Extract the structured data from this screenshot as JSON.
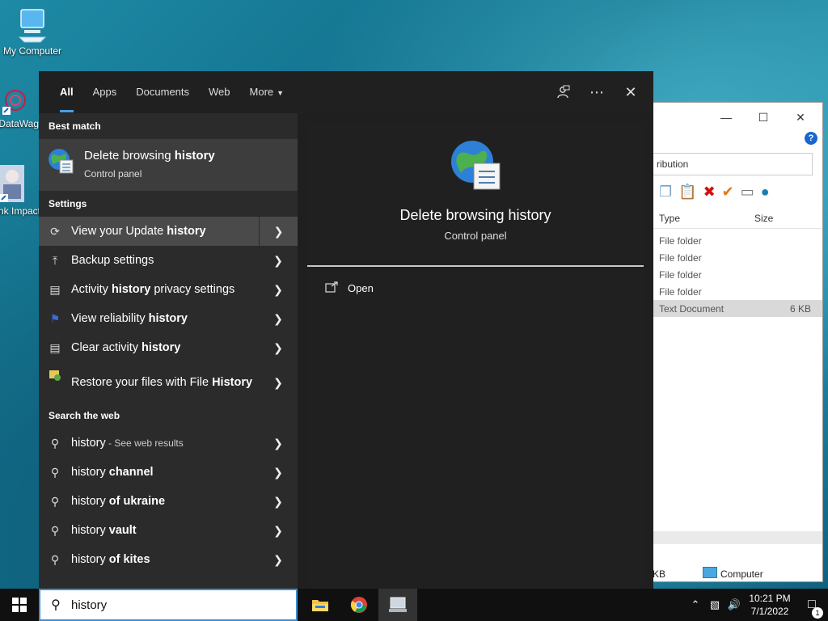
{
  "desktop": {
    "icons": [
      {
        "label": "My Computer"
      },
      {
        "label": "DataWag"
      },
      {
        "label": "Honk Impact"
      }
    ]
  },
  "explorer": {
    "address_partial": "ribution",
    "columns": {
      "type": "Type",
      "size": "Size"
    },
    "rows": [
      {
        "type": "File folder",
        "size": ""
      },
      {
        "type": "File folder",
        "size": ""
      },
      {
        "type": "File folder",
        "size": ""
      },
      {
        "type": "File folder",
        "size": ""
      },
      {
        "type": "Text Document",
        "size": "6 KB"
      }
    ],
    "status_left": "KB",
    "status_location": "Computer"
  },
  "search": {
    "tabs": [
      {
        "label": "All"
      },
      {
        "label": "Apps"
      },
      {
        "label": "Documents"
      },
      {
        "label": "Web"
      },
      {
        "label": "More"
      }
    ],
    "best_match_heading": "Best match",
    "best_match": {
      "title_pre": "Delete browsing ",
      "title_bold": "history",
      "subtitle": "Control panel"
    },
    "settings_heading": "Settings",
    "settings": [
      {
        "pre": "View your Update ",
        "bold": "history",
        "post": "",
        "icon": "refresh-icon"
      },
      {
        "pre": "Backup settings",
        "bold": "",
        "post": "",
        "icon": "upload-arrow-icon"
      },
      {
        "pre": "Activity ",
        "bold": "history",
        "post": " privacy settings",
        "icon": "timeline-icon"
      },
      {
        "pre": "View reliability ",
        "bold": "history",
        "post": "",
        "icon": "flag-icon"
      },
      {
        "pre": "Clear activity ",
        "bold": "history",
        "post": "",
        "icon": "timeline-icon"
      },
      {
        "pre": "Restore your files with File ",
        "bold": "History",
        "post": "",
        "icon": "file-history-icon"
      }
    ],
    "web_heading": "Search the web",
    "web": [
      {
        "pre": "history",
        "bold": "",
        "note": " - See web results"
      },
      {
        "pre": "history ",
        "bold": "channel",
        "note": ""
      },
      {
        "pre": "history ",
        "bold": "of ukraine",
        "note": ""
      },
      {
        "pre": "history ",
        "bold": "vault",
        "note": ""
      },
      {
        "pre": "history ",
        "bold": "of kites",
        "note": ""
      }
    ],
    "preview": {
      "title": "Delete browsing history",
      "subtitle": "Control panel",
      "open_label": "Open"
    },
    "query": "history"
  },
  "taskbar": {
    "time": "10:21 PM",
    "date": "7/1/2022",
    "notification_count": "1"
  },
  "colors": {
    "accent": "#4a9fe0",
    "panel": "#2b2b2b",
    "highlight": "#3d3d3d"
  }
}
